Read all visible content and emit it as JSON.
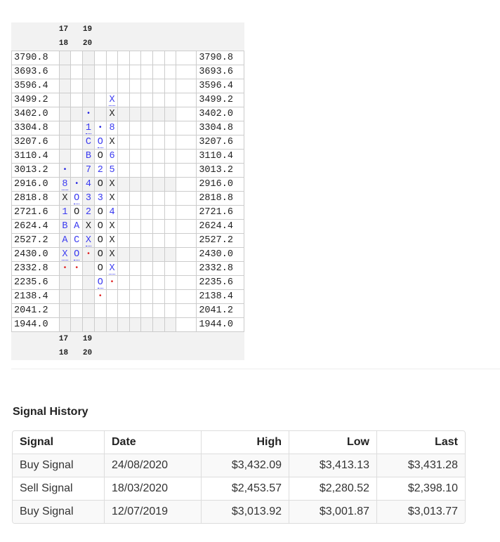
{
  "chart": {
    "year_labels_top": [
      "17",
      "19"
    ],
    "year_labels_bottom": [
      "18",
      "20"
    ],
    "rows": [
      {
        "price": "3790.8",
        "cells": [
          "",
          "",
          "",
          "",
          ""
        ]
      },
      {
        "price": "3693.6",
        "cells": [
          "",
          "",
          "",
          "",
          ""
        ]
      },
      {
        "price": "3596.4",
        "cells": [
          "",
          "",
          "",
          "",
          ""
        ]
      },
      {
        "price": "3499.2",
        "cells": [
          "",
          "",
          "",
          "",
          "u:X"
        ]
      },
      {
        "price": "3402.0",
        "cells": [
          "",
          "",
          "d:•",
          "",
          "k:X"
        ]
      },
      {
        "price": "3304.8",
        "cells": [
          "",
          "",
          "u:1",
          "d:•",
          "b:8"
        ]
      },
      {
        "price": "3207.6",
        "cells": [
          "",
          "",
          "b:C",
          "u:O",
          "k:X"
        ]
      },
      {
        "price": "3110.4",
        "cells": [
          "",
          "",
          "b:B",
          "k:O",
          "b:6"
        ]
      },
      {
        "price": "3013.2",
        "cells": [
          "d:•",
          "",
          "b:7",
          "b:2",
          "b:5"
        ]
      },
      {
        "price": "2916.0",
        "cells": [
          "u:8",
          "d:•",
          "b:4",
          "k:O",
          "k:X"
        ]
      },
      {
        "price": "2818.8",
        "cells": [
          "k:X",
          "u:O",
          "b:3",
          "b:3",
          "k:X"
        ]
      },
      {
        "price": "2721.6",
        "cells": [
          "b:1",
          "k:O",
          "b:2",
          "k:O",
          "b:4"
        ]
      },
      {
        "price": "2624.4",
        "cells": [
          "b:B",
          "b:A",
          "k:X",
          "k:O",
          "k:X"
        ]
      },
      {
        "price": "2527.2",
        "cells": [
          "b:A",
          "b:C",
          "u:X",
          "k:O",
          "k:X"
        ]
      },
      {
        "price": "2430.0",
        "cells": [
          "u:X",
          "u:O",
          "r:•",
          "k:O",
          "k:X"
        ]
      },
      {
        "price": "2332.8",
        "cells": [
          "r:•",
          "r:•",
          "",
          "k:O",
          "u:X"
        ]
      },
      {
        "price": "2235.6",
        "cells": [
          "",
          "",
          "",
          "u:O",
          "r:•"
        ]
      },
      {
        "price": "2138.4",
        "cells": [
          "",
          "",
          "",
          "r:•",
          ""
        ]
      },
      {
        "price": "2041.2",
        "cells": [
          "",
          "",
          "",
          "",
          ""
        ]
      },
      {
        "price": "1944.0",
        "cells": [
          "",
          "",
          "",
          "",
          ""
        ]
      }
    ],
    "colors": {
      "blue": "#3b3bf0",
      "red": "#e02020"
    }
  },
  "signal_history": {
    "title": "Signal History",
    "headers": [
      "Signal",
      "Date",
      "High",
      "Low",
      "Last"
    ],
    "rows": [
      [
        "Buy Signal",
        "24/08/2020",
        "$3,432.09",
        "$3,413.13",
        "$3,431.28"
      ],
      [
        "Sell Signal",
        "18/03/2020",
        "$2,453.57",
        "$2,280.52",
        "$2,398.10"
      ],
      [
        "Buy Signal",
        "12/07/2019",
        "$3,013.92",
        "$3,001.87",
        "$3,013.77"
      ]
    ]
  }
}
